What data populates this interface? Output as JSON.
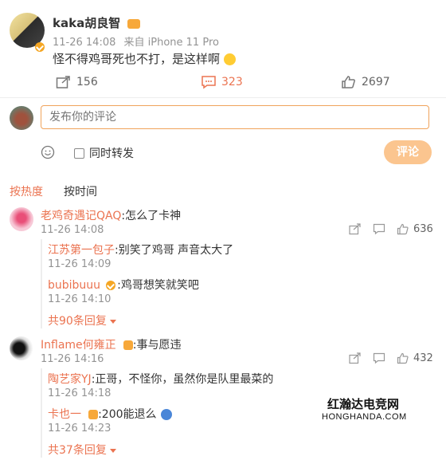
{
  "post": {
    "author": "kaka胡良智",
    "time": "11-26 14:08",
    "source": "来自 iPhone 11 Pro",
    "content": "怪不得鸡哥死也不打，是这样啊",
    "repost_count": "156",
    "comment_count": "323",
    "like_count": "2697"
  },
  "composer": {
    "placeholder": "发布你的评论",
    "also_repost": "同时转发",
    "submit": "评论"
  },
  "sort": {
    "hot": "按热度",
    "time": "按时间"
  },
  "comments": [
    {
      "author": "老鸡奇遇记QAQ",
      "text": ":怎么了卡神",
      "time": "11-26 14:08",
      "likes": "636",
      "replies": [
        {
          "author": "江苏第一包子",
          "text": ":别笑了鸡哥 声音太大了",
          "time": "11-26 14:09"
        },
        {
          "author": "bubibuuu",
          "text": ":鸡哥想笑就笑吧",
          "time": "11-26 14:10"
        }
      ],
      "more": "共90条回复"
    },
    {
      "author": "Inflame何雍正",
      "text": ":事与愿违",
      "time": "11-26 14:16",
      "likes": "432",
      "replies": [
        {
          "author": "陶艺家YJ",
          "text": ":正哥，不怪你，虽然你是队里最菜的",
          "time": "11-26 14:18"
        },
        {
          "author": "卡也一",
          "text": ":200能退么",
          "time": "11-26 14:23"
        }
      ],
      "more": "共37条回复"
    }
  ],
  "watermark": {
    "cn": "红瀚达电竞网",
    "en": "HONGHANDA.COM"
  }
}
